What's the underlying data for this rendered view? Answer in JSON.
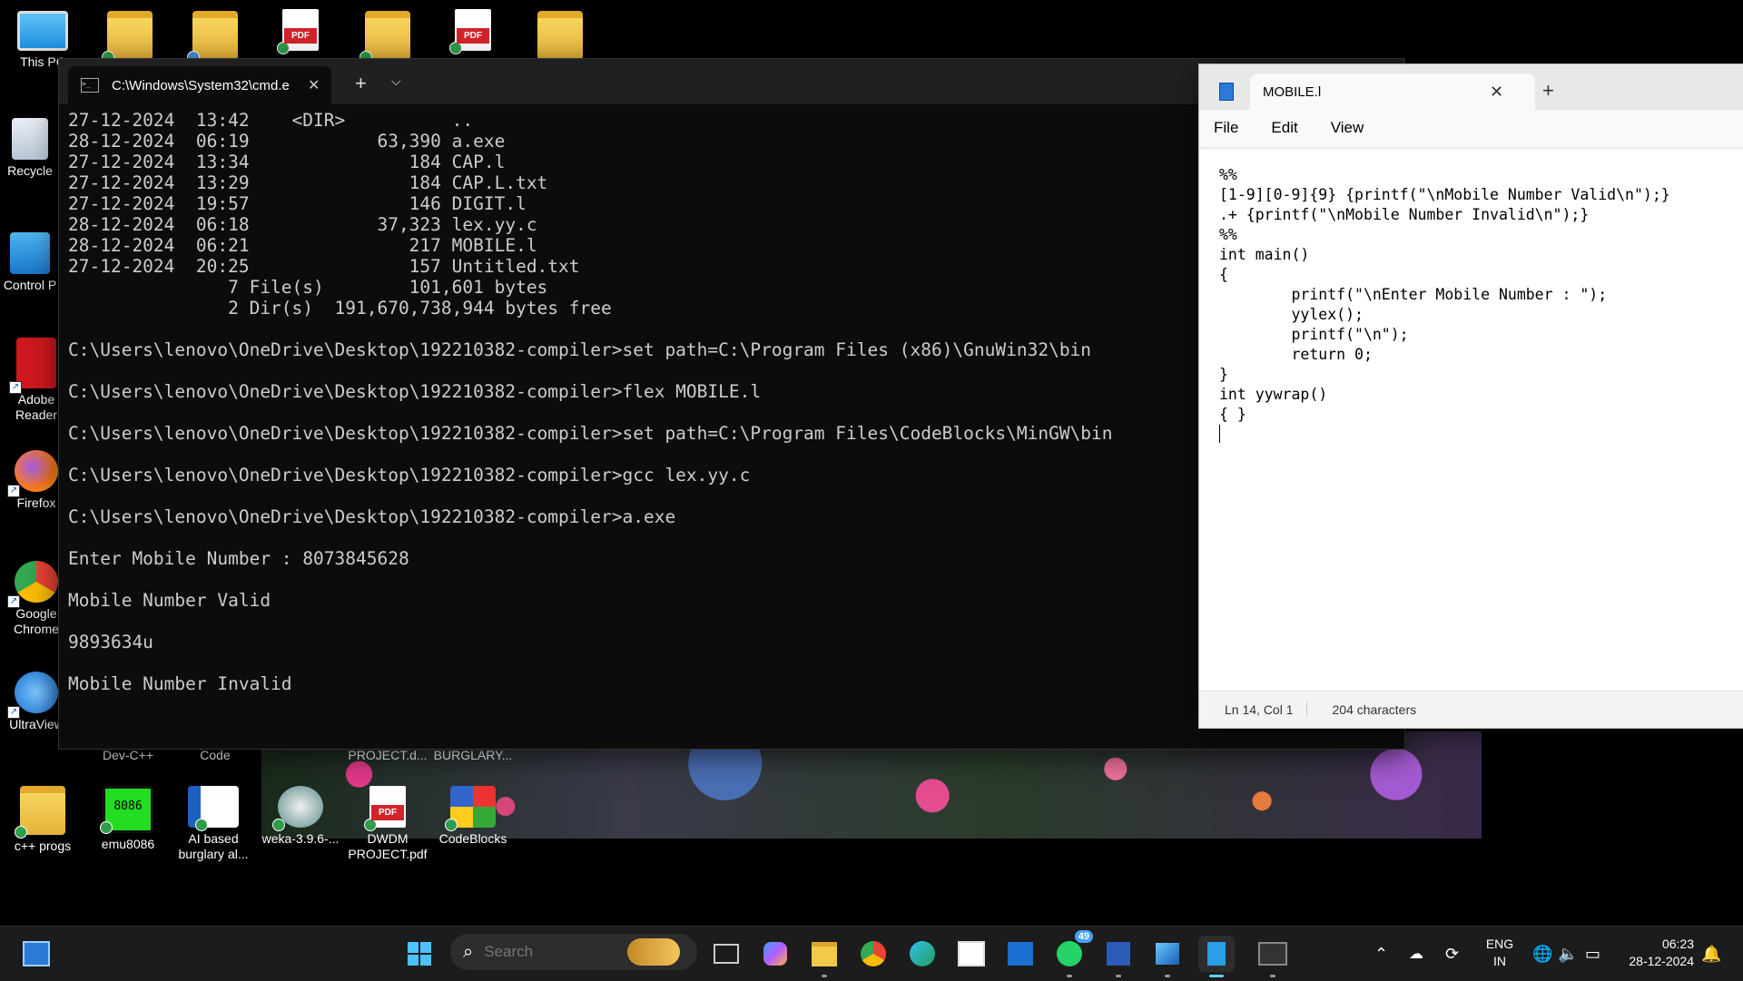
{
  "desktop": {
    "top_icons": [
      {
        "label": "This PC",
        "icon": "monitor-icon"
      },
      {
        "label": "",
        "icon": "folder-icon"
      },
      {
        "label": "",
        "icon": "folder-icon"
      },
      {
        "label": "",
        "icon": "pdf-icon"
      },
      {
        "label": "",
        "icon": "folder-icon"
      },
      {
        "label": "",
        "icon": "pdf-icon"
      },
      {
        "label": "",
        "icon": "folder-icon"
      }
    ],
    "left_icons": [
      {
        "label": "Recycle",
        "icon": "recycle-bin-icon"
      },
      {
        "label": "Control P",
        "icon": "control-panel-icon"
      },
      {
        "label": "Adobe Reader",
        "icon": "adobe-reader-icon"
      },
      {
        "label": "Firefox",
        "icon": "firefox-icon"
      },
      {
        "label": "Google Chrome",
        "icon": "chrome-icon"
      },
      {
        "label": "UltraView",
        "icon": "ultraviewer-icon"
      }
    ],
    "middle_labels": [
      "Dev-C++",
      "Code",
      "PROJECT.d...",
      "BURGLARY..."
    ],
    "bottom_icons": [
      {
        "label": "c++ progs",
        "icon": "folder-icon"
      },
      {
        "label": "emu8086",
        "icon": "emu8086-icon",
        "glyph_text": "8086"
      },
      {
        "label": "AI based burglary al...",
        "icon": "word-doc-icon"
      },
      {
        "label": "weka-3.9.6-...",
        "icon": "weka-icon"
      },
      {
        "label": "DWDM PROJECT.pdf",
        "icon": "pdf-icon"
      },
      {
        "label": "CodeBlocks",
        "icon": "codeblocks-icon"
      }
    ]
  },
  "terminal": {
    "tab_title": "C:\\Windows\\System32\\cmd.e",
    "close_glyph": "✕",
    "new_tab_glyph": "+",
    "dropdown_glyph": "⌵",
    "lines": [
      "27-12-2024  13:42    <DIR>          ..",
      "28-12-2024  06:19            63,390 a.exe",
      "27-12-2024  13:34               184 CAP.l",
      "27-12-2024  13:29               184 CAP.L.txt",
      "27-12-2024  19:57               146 DIGIT.l",
      "28-12-2024  06:18            37,323 lex.yy.c",
      "28-12-2024  06:21               217 MOBILE.l",
      "27-12-2024  20:25               157 Untitled.txt",
      "               7 File(s)        101,601 bytes",
      "               2 Dir(s)  191,670,738,944 bytes free",
      "",
      "C:\\Users\\lenovo\\OneDrive\\Desktop\\192210382-compiler>set path=C:\\Program Files (x86)\\GnuWin32\\bin",
      "",
      "C:\\Users\\lenovo\\OneDrive\\Desktop\\192210382-compiler>flex MOBILE.l",
      "",
      "C:\\Users\\lenovo\\OneDrive\\Desktop\\192210382-compiler>set path=C:\\Program Files\\CodeBlocks\\MinGW\\bin",
      "",
      "C:\\Users\\lenovo\\OneDrive\\Desktop\\192210382-compiler>gcc lex.yy.c",
      "",
      "C:\\Users\\lenovo\\OneDrive\\Desktop\\192210382-compiler>a.exe",
      "",
      "Enter Mobile Number : 8073845628",
      "",
      "Mobile Number Valid",
      "",
      "9893634u",
      "",
      "Mobile Number Invalid"
    ]
  },
  "notepad": {
    "tab_title": "MOBILE.l",
    "close_glyph": "✕",
    "new_tab_glyph": "+",
    "menu": [
      "File",
      "Edit",
      "View"
    ],
    "code_lines": [
      "%%",
      "[1-9][0-9]{9} {printf(\"\\nMobile Number Valid\\n\");}",
      ".+ {printf(\"\\nMobile Number Invalid\\n\");}",
      "%%",
      "int main()",
      "{",
      "        printf(\"\\nEnter Mobile Number : \");",
      "        yylex();",
      "        printf(\"\\n\");",
      "        return 0;",
      "}",
      "int yywrap()",
      "{ }"
    ],
    "status": {
      "position": "Ln 14, Col 1",
      "characters": "204 characters"
    }
  },
  "taskbar": {
    "search_placeholder": "Search",
    "apps": [
      {
        "name": "task-view-icon"
      },
      {
        "name": "copilot-icon"
      },
      {
        "name": "file-explorer-icon"
      },
      {
        "name": "chrome-icon"
      },
      {
        "name": "edge-icon"
      },
      {
        "name": "microsoft-store-icon"
      },
      {
        "name": "outlook-icon"
      },
      {
        "name": "whatsapp-icon",
        "badge": "49"
      },
      {
        "name": "word-icon"
      },
      {
        "name": "photos-icon"
      },
      {
        "name": "notepad-icon"
      },
      {
        "name": "terminal-icon"
      }
    ],
    "language": {
      "line1": "ENG",
      "line2": "IN"
    },
    "time": "06:23",
    "date": "28-12-2024"
  },
  "colors": {
    "terminal_bg": "#0c0c0c",
    "terminal_text": "#cccccc",
    "accent": "#60cdff"
  }
}
